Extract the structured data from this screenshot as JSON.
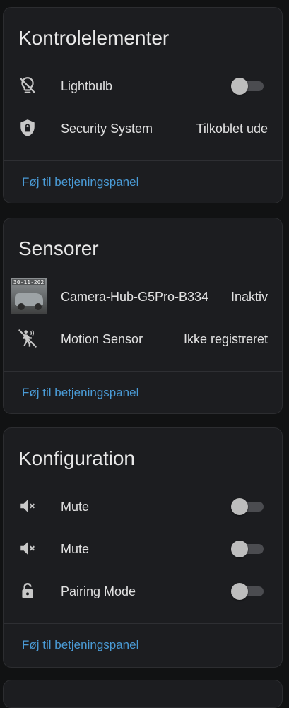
{
  "colors": {
    "background": "#111213",
    "card": "#1c1d20",
    "link": "#4a9bd6",
    "icon": "#c8c8c8"
  },
  "controls": {
    "title": "Kontrolelementer",
    "items": [
      {
        "icon": "lightbulb-off-icon",
        "label": "Lightbulb",
        "toggle": false
      },
      {
        "icon": "shield-lock-icon",
        "label": "Security System",
        "state": "Tilkoblet ude"
      }
    ],
    "footer": "Føj til betjeningspanel"
  },
  "sensors": {
    "title": "Sensorer",
    "items": [
      {
        "icon": "camera-thumbnail",
        "label": "Camera-Hub-G5Pro-B334",
        "state": "Inaktiv",
        "thumb_stamp": "30-11-202"
      },
      {
        "icon": "motion-sensor-off-icon",
        "label": "Motion Sensor",
        "state": "Ikke registreret"
      }
    ],
    "footer": "Føj til betjeningspanel"
  },
  "configuration": {
    "title": "Konfiguration",
    "items": [
      {
        "icon": "volume-mute-icon",
        "label": "Mute",
        "toggle": false
      },
      {
        "icon": "volume-mute-icon",
        "label": "Mute",
        "toggle": false
      },
      {
        "icon": "lock-open-icon",
        "label": "Pairing Mode",
        "toggle": false
      }
    ],
    "footer": "Føj til betjeningspanel"
  }
}
